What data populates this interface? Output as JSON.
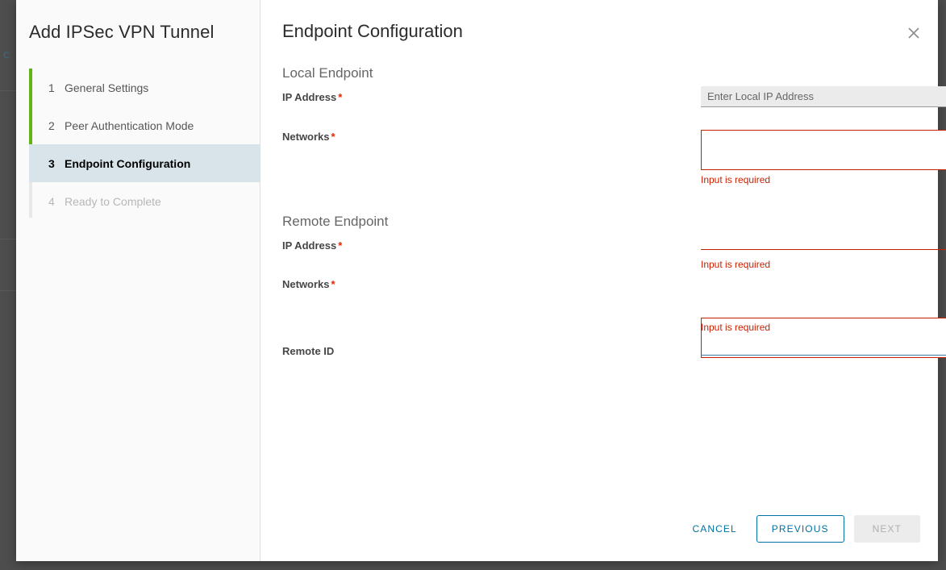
{
  "wizard": {
    "title": "Add IPSec VPN Tunnel",
    "steps": [
      {
        "num": "1",
        "label": "General Settings",
        "state": "done"
      },
      {
        "num": "2",
        "label": "Peer Authentication Mode",
        "state": "done"
      },
      {
        "num": "3",
        "label": "Endpoint Configuration",
        "state": "active"
      },
      {
        "num": "4",
        "label": "Ready to Complete",
        "state": "disabled"
      }
    ]
  },
  "content": {
    "title": "Endpoint Configuration",
    "close_icon": "close-icon"
  },
  "local_endpoint": {
    "section_title": "Local Endpoint",
    "ip_address": {
      "label": "IP Address",
      "required": "*",
      "placeholder": "Enter Local IP Address",
      "value": "",
      "chevron_icon": "chevron-down-icon",
      "info_icon": "info-icon"
    },
    "networks": {
      "label": "Networks",
      "required": "*",
      "value": "",
      "error": "Input is required",
      "error_icon": "error-icon"
    }
  },
  "remote_endpoint": {
    "section_title": "Remote Endpoint",
    "ip_address": {
      "label": "IP Address",
      "required": "*",
      "value": "",
      "error": "Input is required",
      "error_icon": "error-icon"
    },
    "networks": {
      "label": "Networks",
      "required": "*",
      "value": "",
      "error": "Input is required",
      "error_icon": "error-icon"
    },
    "remote_id": {
      "label": "Remote ID",
      "value": "",
      "info_icon": "info-icon"
    }
  },
  "footer": {
    "cancel_label": "CANCEL",
    "previous_label": "PREVIOUS",
    "next_label": "NEXT"
  },
  "colors": {
    "accent_blue": "#0072a3",
    "error_red": "#c92100",
    "required_red": "#e62700",
    "progress_green": "#60b515",
    "active_step_bg": "#d9e4ea"
  }
}
